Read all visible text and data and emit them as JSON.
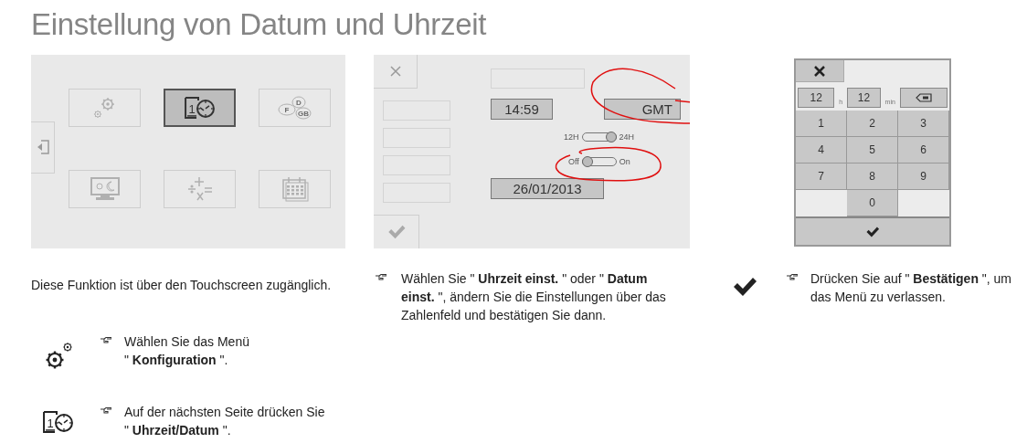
{
  "title": "Einstellung von Datum und Uhrzeit",
  "menu_screen": {
    "tiles": [
      {
        "kind": "settings",
        "selected": false
      },
      {
        "kind": "datetime",
        "selected": true,
        "glyph": "1"
      },
      {
        "kind": "languages",
        "selected": false,
        "labels": [
          "F",
          "D",
          "GB"
        ]
      },
      {
        "kind": "display",
        "selected": false
      },
      {
        "kind": "calculator",
        "selected": false
      },
      {
        "kind": "calendar",
        "selected": false
      }
    ]
  },
  "settings_screen": {
    "time": "14:59",
    "timezone": "GMT",
    "switches": [
      {
        "left": "12H",
        "right": "24H",
        "on": true
      },
      {
        "left": "Off",
        "right": "On",
        "on": false
      }
    ],
    "date": "26/01/2013"
  },
  "keypad_screen": {
    "hours": "12",
    "hours_unit": "h",
    "minutes": "12",
    "minutes_unit": "min",
    "keys": [
      "1",
      "2",
      "3",
      "4",
      "5",
      "6",
      "7",
      "8",
      "9",
      "0"
    ]
  },
  "columns": [
    {
      "intro": "Diese Funktion ist über den Touchscreen zugänglich.",
      "steps": [
        {
          "kind": "settings",
          "text": "Wählen Sie das Menü\n\" **Konfiguration** \"."
        },
        {
          "kind": "datetime",
          "glyph": "1",
          "text": "Auf der nächsten Seite drücken Sie\n\" **Uhrzeit/Datum** \"."
        }
      ]
    },
    {
      "steps": [
        {
          "text": "Wählen Sie \" **Uhrzeit einst.** \" oder \" **Datum einst.** \", ändern Sie die Einstellungen über das Zahlenfeld und bestätigen Sie dann."
        }
      ]
    },
    {
      "steps": [
        {
          "kind": "check",
          "text": "Drücken Sie auf \" **Bestätigen** \", um das Menü zu verlassen."
        }
      ]
    }
  ]
}
